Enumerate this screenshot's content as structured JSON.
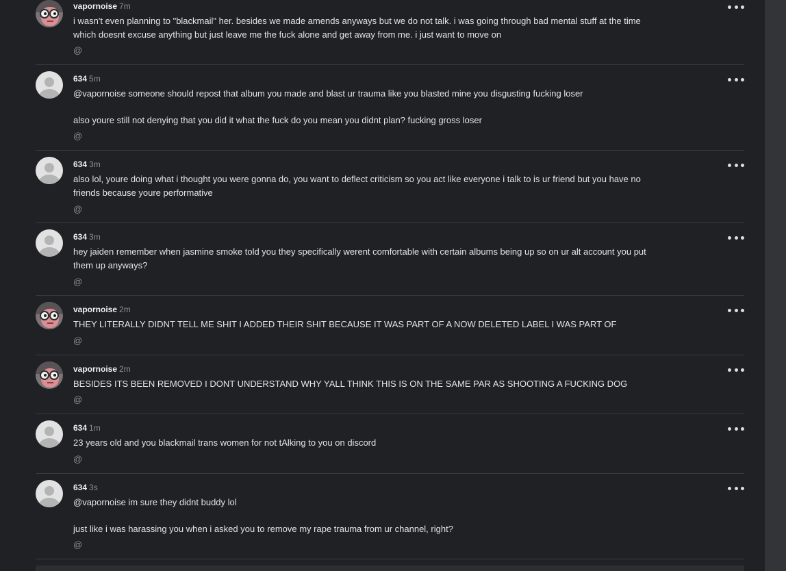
{
  "comments": [
    {
      "author": "vapornoise",
      "time": "7m",
      "avatar": "vapornoise-avatar",
      "paragraphs": [
        "i wasn't even planning to \"blackmail\" her. besides we made amends anyways but we do not talk. i was going through bad mental stuff at the time which doesnt excuse anything but just leave me the fuck alone and get away from me. i just want to move on"
      ]
    },
    {
      "author": "634",
      "time": "5m",
      "avatar": "default-avatar",
      "paragraphs": [
        "@vapornoise someone should repost that album you made and blast ur trauma like you blasted mine you disgusting fucking loser",
        "also youre still not denying that you did it what the fuck do you mean you didnt plan? fucking gross loser"
      ]
    },
    {
      "author": "634",
      "time": "3m",
      "avatar": "default-avatar",
      "paragraphs": [
        "also lol, youre doing what i thought you were gonna do, you want to deflect criticism so you act like everyone i talk to is ur friend but you have no friends because youre performative"
      ]
    },
    {
      "author": "634",
      "time": "3m",
      "avatar": "default-avatar",
      "paragraphs": [
        "hey jaiden remember when jasmine smoke told you they specifically werent comfortable with certain albums being up so on ur alt account you put them up anyways?"
      ]
    },
    {
      "author": "vapornoise",
      "time": "2m",
      "avatar": "vapornoise-avatar",
      "paragraphs": [
        "THEY LITERALLY DIDNT TELL ME SHIT I ADDED THEIR SHIT BECAUSE IT WAS PART OF A NOW DELETED LABEL I WAS PART OF"
      ]
    },
    {
      "author": "vapornoise",
      "time": "2m",
      "avatar": "vapornoise-avatar",
      "paragraphs": [
        "BESIDES ITS BEEN REMOVED I DONT UNDERSTAND WHY YALL THINK THIS IS ON THE SAME PAR AS SHOOTING A FUCKING DOG"
      ]
    },
    {
      "author": "634",
      "time": "1m",
      "avatar": "default-avatar",
      "paragraphs": [
        "23 years old and you blackmail trans women for not tAlking to you on discord"
      ]
    },
    {
      "author": "634",
      "time": "3s",
      "avatar": "default-avatar",
      "paragraphs": [
        "@vapornoise im sure they didnt buddy lol",
        "just like i was harassing you when i asked you to remove my rape trauma from ur channel, right?"
      ]
    }
  ],
  "ui": {
    "mention_label": "@",
    "more_icon": "more-horizontal-icon"
  },
  "colors": {
    "background": "#202125",
    "scrollbar_gutter": "#333438",
    "separator": "#3a3b3f",
    "muted_text": "#8e8f94"
  }
}
